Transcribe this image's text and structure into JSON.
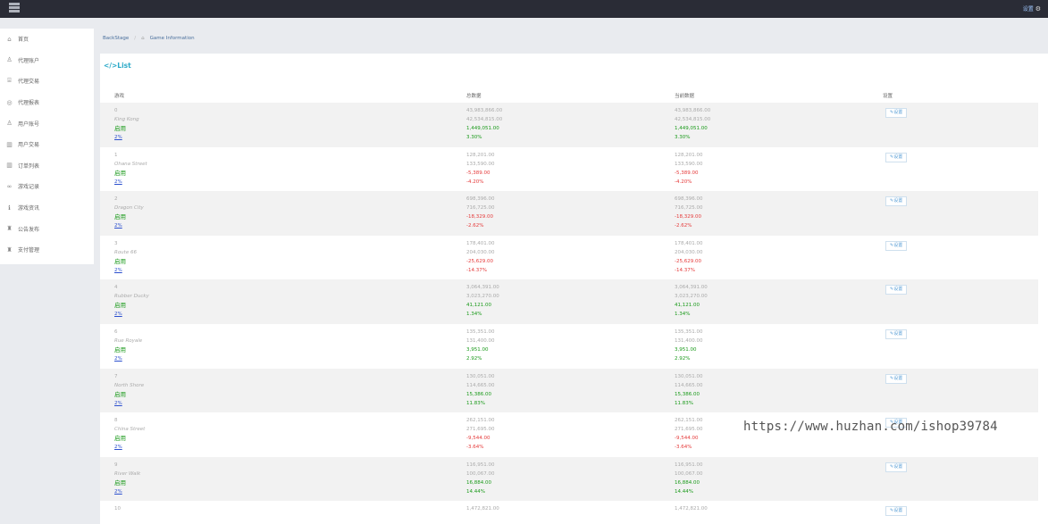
{
  "header": {
    "settings_label": "设置"
  },
  "sidebar": {
    "items": [
      {
        "label": "首页",
        "icon": "home-icon",
        "glyph": "⌂"
      },
      {
        "label": "代理账户",
        "icon": "user-lock-icon",
        "glyph": "♙"
      },
      {
        "label": "代理交易",
        "icon": "bank-icon",
        "glyph": "⌸"
      },
      {
        "label": "代理报表",
        "icon": "lifebuoy-icon",
        "glyph": "◎"
      },
      {
        "label": "用户账号",
        "icon": "user-icon",
        "glyph": "♙"
      },
      {
        "label": "用户交易",
        "icon": "columns-icon",
        "glyph": "▥"
      },
      {
        "label": "订单列表",
        "icon": "columns-icon",
        "glyph": "▥"
      },
      {
        "label": "游戏记录",
        "icon": "gamepad-icon",
        "glyph": "∞"
      },
      {
        "label": "游戏资讯",
        "icon": "info-icon",
        "glyph": "ℹ"
      },
      {
        "label": "公告发布",
        "icon": "bell-icon",
        "glyph": "♜"
      },
      {
        "label": "支付管理",
        "icon": "bell-icon",
        "glyph": "♜"
      }
    ]
  },
  "breadcrumb": {
    "root": "BackStage",
    "current": "Game Information"
  },
  "main": {
    "title": "</>List",
    "headers": [
      "游戏",
      "总数据",
      "当前数据",
      "设置"
    ],
    "button_label": "设置",
    "rows": [
      {
        "idx": "0",
        "name": "King Kong",
        "status": "启用",
        "pct_link": "2%",
        "a": "43,983,866.00",
        "b": "42,534,815.00",
        "c": "1,449,051.00",
        "d": "3.30%",
        "neg": false
      },
      {
        "idx": "1",
        "name": "Ohana Street",
        "status": "启用",
        "pct_link": "2%",
        "a": "128,201.00",
        "b": "133,590.00",
        "c": "-5,389.00",
        "d": "-4.20%",
        "neg": true
      },
      {
        "idx": "2",
        "name": "Dragon City",
        "status": "启用",
        "pct_link": "2%",
        "a": "698,396.00",
        "b": "716,725.00",
        "c": "-18,329.00",
        "d": "-2.62%",
        "neg": true
      },
      {
        "idx": "3",
        "name": "Route 66",
        "status": "启用",
        "pct_link": "2%",
        "a": "178,401.00",
        "b": "204,030.00",
        "c": "-25,629.00",
        "d": "-14.37%",
        "neg": true
      },
      {
        "idx": "4",
        "name": "Rubber Ducky",
        "status": "启用",
        "pct_link": "2%",
        "a": "3,064,391.00",
        "b": "3,023,270.00",
        "c": "41,121.00",
        "d": "1.34%",
        "neg": false
      },
      {
        "idx": "6",
        "name": "Rue Royale",
        "status": "启用",
        "pct_link": "2%",
        "a": "135,351.00",
        "b": "131,400.00",
        "c": "3,951.00",
        "d": "2.92%",
        "neg": false
      },
      {
        "idx": "7",
        "name": "North Shore",
        "status": "启用",
        "pct_link": "2%",
        "a": "130,051.00",
        "b": "114,665.00",
        "c": "15,386.00",
        "d": "11.83%",
        "neg": false
      },
      {
        "idx": "8",
        "name": "China Street",
        "status": "启用",
        "pct_link": "2%",
        "a": "262,151.00",
        "b": "271,695.00",
        "c": "-9,544.00",
        "d": "-3.64%",
        "neg": true
      },
      {
        "idx": "9",
        "name": "River Walk",
        "status": "启用",
        "pct_link": "2%",
        "a": "116,951.00",
        "b": "100,067.00",
        "c": "16,884.00",
        "d": "14.44%",
        "neg": false
      },
      {
        "idx": "10",
        "name": "",
        "status": "",
        "pct_link": "",
        "a": "1,472,821.00",
        "b": "",
        "c": "",
        "d": "",
        "neg": false
      }
    ]
  },
  "watermark": "https://www.huzhan.com/ishop39784"
}
